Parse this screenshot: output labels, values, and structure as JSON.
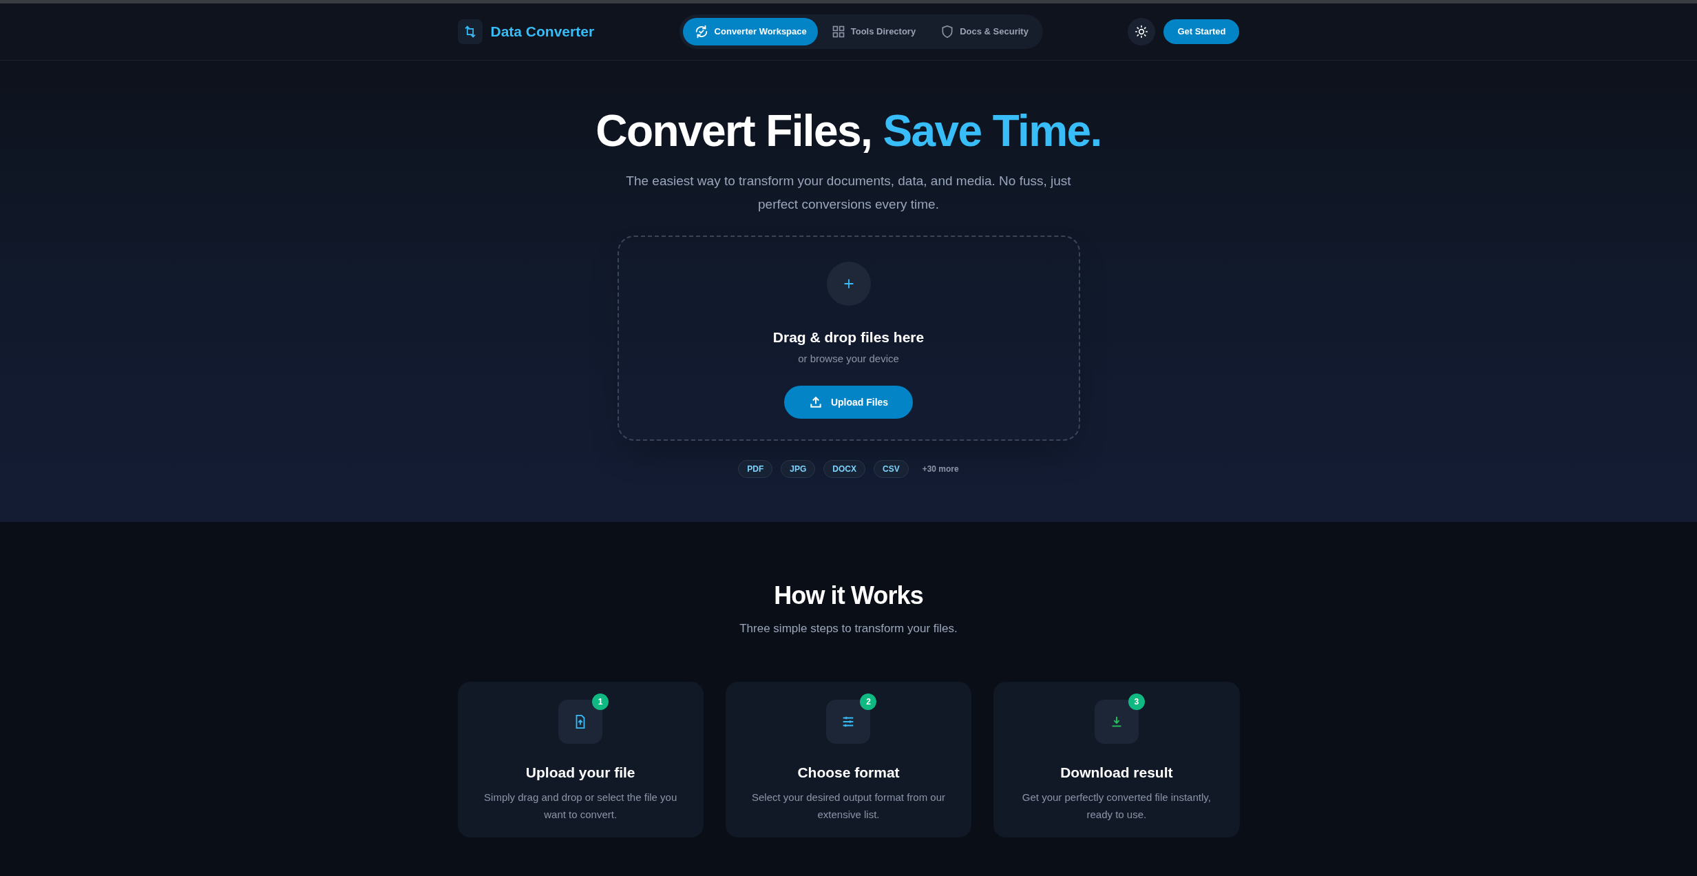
{
  "brand": {
    "name": "Data Converter"
  },
  "nav_tabs": [
    {
      "label": "Converter Workspace",
      "selected": true
    },
    {
      "label": "Tools Directory",
      "selected": false
    },
    {
      "label": "Docs & Security",
      "selected": false
    }
  ],
  "header_actions": {
    "cta": "Get Started"
  },
  "hero": {
    "title": "Convert Files,",
    "title_highlight": "Save Time.",
    "subtitle": "The easiest way to transform your documents, data, and media. No fuss, just perfect conversions every time.",
    "dropzone": {
      "heading": "Drag & drop files here",
      "subheading": "or browse your device",
      "button": "Upload Files"
    },
    "formats": [
      "PDF",
      "JPG",
      "DOCX",
      "CSV"
    ],
    "more": "+30 more"
  },
  "how_it_works": {
    "title": "How it Works",
    "subtitle": "Three simple steps to transform your files.",
    "steps": [
      {
        "number": "1",
        "title": "Upload your file",
        "text": "Simply drag and drop or select the file you want to convert."
      },
      {
        "number": "2",
        "title": "Choose format",
        "text": "Select your desired output format from our extensive list."
      },
      {
        "number": "3",
        "title": "Download result",
        "text": "Get your perfectly converted file instantly, ready to use."
      }
    ]
  }
}
